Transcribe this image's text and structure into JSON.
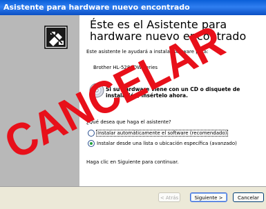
{
  "window": {
    "title": "Asistente para hardware nuevo encontrado"
  },
  "wizard": {
    "heading": "Éste es el Asistente para hardware nuevo encontrado",
    "intro": "Este asistente le ayudará a instalar software para:",
    "device": "Brother HL-5280DW series",
    "cd_note": "Si su hardware viene con un CD o disquete de instalación, insértelo ahora.",
    "question": "¿Qué desea que haga el asistente?",
    "options": [
      {
        "label": "Instalar automáticamente el software (recomendado)",
        "selected": false
      },
      {
        "label": "Instalar desde una lista o ubicación específica (avanzado)",
        "selected": true
      }
    ],
    "continue_text": "Haga clic en Siguiente para continuar."
  },
  "buttons": {
    "back": "< Atrás",
    "next": "Siguiente >",
    "cancel": "Cancelar"
  },
  "overlay": {
    "text": "CANCELAR",
    "color": "#e8101a"
  },
  "icons": {
    "hardware": "hardware-install-icon",
    "cd": "cd-disc-icon"
  }
}
